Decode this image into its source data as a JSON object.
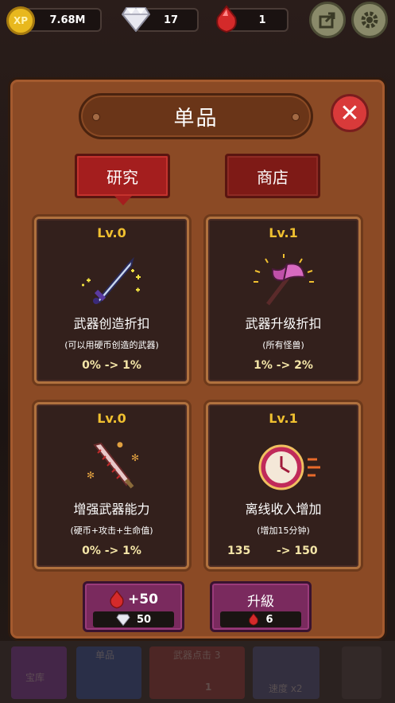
{
  "topbar": {
    "xp_value": "7.68M",
    "xp_icon_text": "XP",
    "diamond_count": "17",
    "ruby_count": "1"
  },
  "modal": {
    "title": "单品",
    "close_icon": "close-icon"
  },
  "tabs": [
    {
      "label": "研究",
      "active": true
    },
    {
      "label": "商店",
      "active": false
    }
  ],
  "cards": [
    {
      "level": "Lv.0",
      "name": "武器创造折扣",
      "desc": "(可以用硬币创造的武器)",
      "value": "0% -> 1%",
      "icon": "sword-sparkle-icon"
    },
    {
      "level": "Lv.1",
      "name": "武器升级折扣",
      "desc": "(所有怪兽)",
      "value": "1% -> 2%",
      "icon": "axe-icon"
    },
    {
      "level": "Lv.0",
      "name": "增强武器能力",
      "desc": "(硬币+攻击+生命值)",
      "value": "0% -> 1%",
      "icon": "serrated-sword-icon"
    },
    {
      "level": "Lv.1",
      "name": "离线收入增加",
      "desc": "(增加15分钟)",
      "value_from": "135",
      "value_to": "-> 150",
      "icon": "clock-icon"
    }
  ],
  "actions": {
    "buy_ruby_label": "+50",
    "buy_ruby_cost": "50",
    "upgrade_label": "升級",
    "upgrade_cost": "6"
  },
  "background": {
    "slot1_text": "单品",
    "slot2_text": "武器点击 3",
    "slot2_count": "1",
    "slot3_text": "速度 x2",
    "slot0_text": "宝库"
  },
  "colors": {
    "modal_bg": "#8b4a25",
    "card_bg": "#33201c",
    "level_gold": "#f0c030",
    "tab_red": "#a41e1e",
    "action_purple": "#7a2a5e"
  }
}
